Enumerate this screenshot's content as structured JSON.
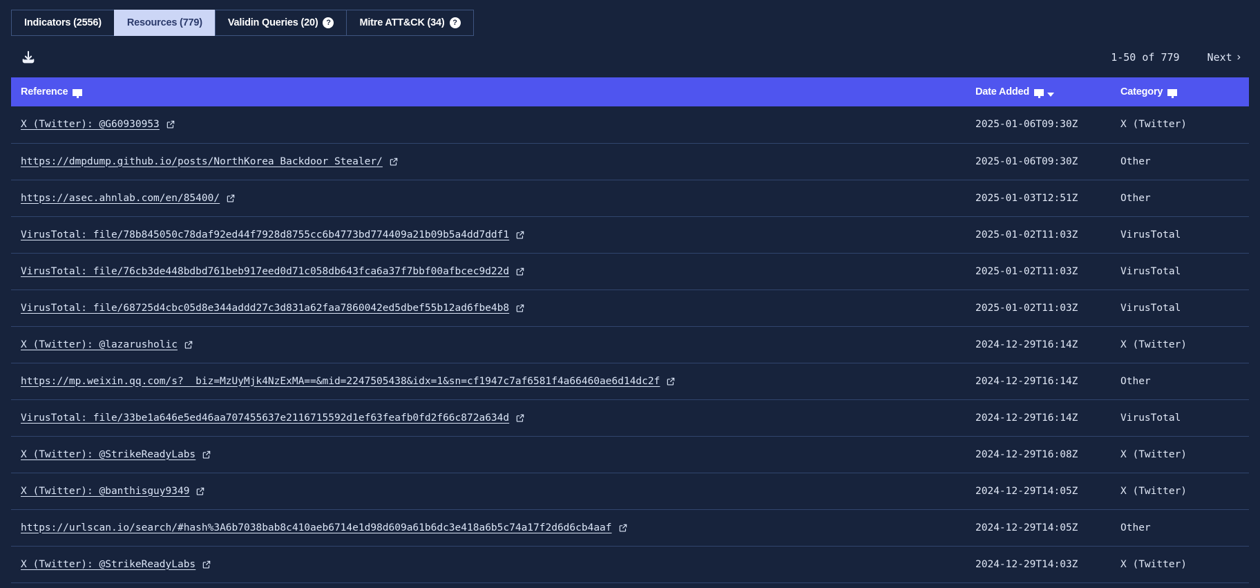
{
  "tabs": [
    {
      "label": "Indicators (2556)",
      "active": false,
      "help": false
    },
    {
      "label": "Resources (779)",
      "active": true,
      "help": false
    },
    {
      "label": "Validin Queries (20)",
      "active": false,
      "help": true,
      "help_glyph": "?"
    },
    {
      "label": "Mitre ATT&CK (34)",
      "active": false,
      "help": true,
      "help_glyph": "?"
    }
  ],
  "toolbar": {
    "download_icon": "download-icon",
    "pagination": {
      "range": "1-50 of 779",
      "next_label": "Next",
      "next_chevron": "›"
    }
  },
  "table": {
    "columns": [
      {
        "label": "Reference",
        "filter": true,
        "sort": null
      },
      {
        "label": "Date Added",
        "filter": true,
        "sort": "desc"
      },
      {
        "label": "Category",
        "filter": true,
        "sort": null
      }
    ],
    "rows": [
      {
        "reference": "X (Twitter): @G60930953",
        "date": "2025-01-06T09:30Z",
        "category": "X (Twitter)"
      },
      {
        "reference": "https://dmpdump.github.io/posts/NorthKorea_Backdoor_Stealer/",
        "date": "2025-01-06T09:30Z",
        "category": "Other"
      },
      {
        "reference": "https://asec.ahnlab.com/en/85400/",
        "date": "2025-01-03T12:51Z",
        "category": "Other"
      },
      {
        "reference": "VirusTotal: file/78b845050c78daf92ed44f7928d8755cc6b4773bd774409a21b09b5a4dd7ddf1",
        "date": "2025-01-02T11:03Z",
        "category": "VirusTotal"
      },
      {
        "reference": "VirusTotal: file/76cb3de448bdbd761beb917eed0d71c058db643fca6a37f7bbf00afbcec9d22d",
        "date": "2025-01-02T11:03Z",
        "category": "VirusTotal"
      },
      {
        "reference": "VirusTotal: file/68725d4cbc05d8e344addd27c3d831a62faa7860042ed5dbef55b12ad6fbe4b8",
        "date": "2025-01-02T11:03Z",
        "category": "VirusTotal"
      },
      {
        "reference": "X (Twitter): @lazarusholic",
        "date": "2024-12-29T16:14Z",
        "category": "X (Twitter)"
      },
      {
        "reference": "https://mp.weixin.qq.com/s?__biz=MzUyMjk4NzExMA==&mid=2247505438&idx=1&sn=cf1947c7af6581f4a66460ae6d14dc2f",
        "date": "2024-12-29T16:14Z",
        "category": "Other"
      },
      {
        "reference": "VirusTotal: file/33be1a646e5ed46aa707455637e2116715592d1ef63feafb0fd2f66c872a634d",
        "date": "2024-12-29T16:14Z",
        "category": "VirusTotal"
      },
      {
        "reference": "X (Twitter): @StrikeReadyLabs",
        "date": "2024-12-29T16:08Z",
        "category": "X (Twitter)"
      },
      {
        "reference": "X (Twitter): @banthisguy9349",
        "date": "2024-12-29T14:05Z",
        "category": "X (Twitter)"
      },
      {
        "reference": "https://urlscan.io/search/#hash%3A6b7038bab8c410aeb6714e1d98d609a61b6dc3e418a6b5c74a17f2d6d6cb4aaf",
        "date": "2024-12-29T14:05Z",
        "category": "Other"
      },
      {
        "reference": "X (Twitter): @StrikeReadyLabs",
        "date": "2024-12-29T14:03Z",
        "category": "X (Twitter)"
      }
    ]
  },
  "colors": {
    "background": "#17233c",
    "header_blue": "#4f55ef",
    "active_tab": "#ccd6f6",
    "row_divider": "#31456e"
  }
}
